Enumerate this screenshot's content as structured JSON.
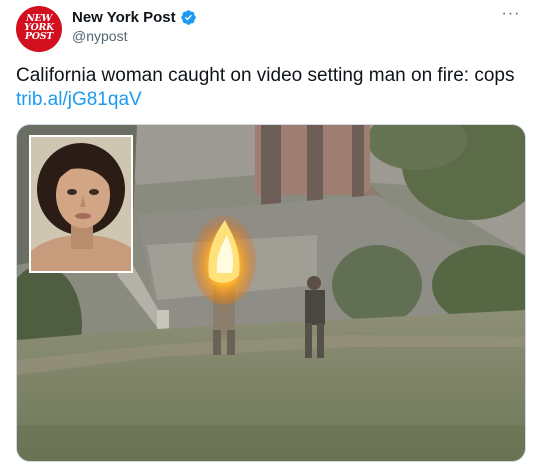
{
  "account": {
    "display_name": "New York Post",
    "handle": "@nypost",
    "avatar_text": [
      "NEW",
      "YORK",
      "POST"
    ],
    "verified_color": "#1d9bf0",
    "brand_color": "#d20f1e"
  },
  "menu": {
    "more_label": "···"
  },
  "tweet": {
    "text": "California woman caught on video setting man on fire: cops",
    "link_text": "trib.al/jG81qaV",
    "link_color": "#1d9bf0"
  },
  "media": {
    "icon": "video-still-image",
    "inset_icon": "mugshot-photo"
  }
}
